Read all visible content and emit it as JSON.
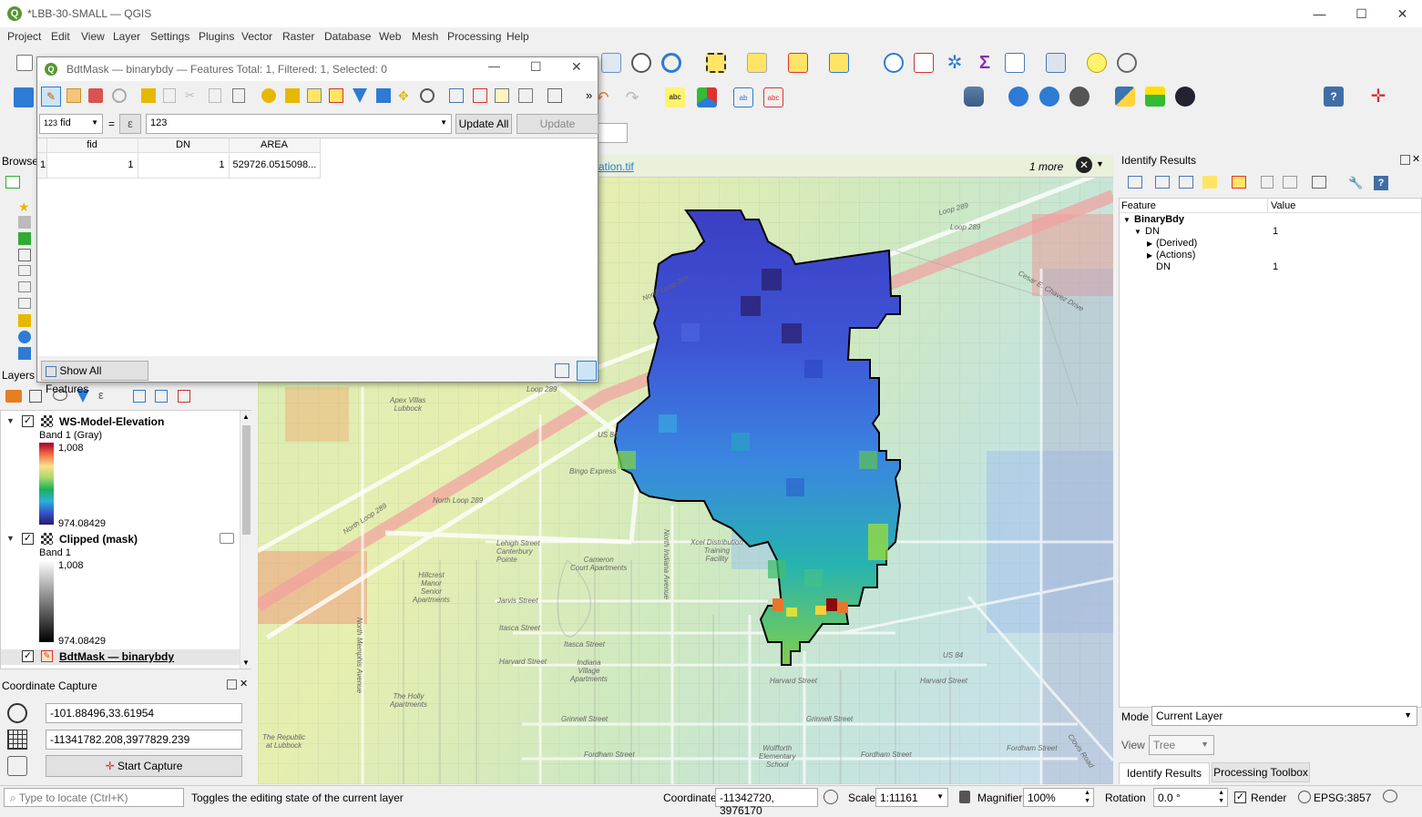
{
  "window": {
    "title": "*LBB-30-SMALL — QGIS",
    "minimize": "—",
    "maximize": "☐",
    "close": "✕"
  },
  "menu": [
    "Project",
    "Edit",
    "View",
    "Layer",
    "Settings",
    "Plugins",
    "Vector",
    "Raster",
    "Database",
    "Web",
    "Mesh",
    "Processing",
    "Help"
  ],
  "attribute_table": {
    "title": "BdtMask — binarybdy — Features Total: 1, Filtered: 1, Selected: 0",
    "field_select": "fid",
    "field_prefix": "123",
    "equals": "=",
    "expression_symbol": "ε",
    "expression_value": "123",
    "update_all": "Update All",
    "update_selected": "Update Selected",
    "more": "»",
    "columns": [
      "fid",
      "DN",
      "AREA"
    ],
    "rows": [
      {
        "row": "1",
        "fid": "1",
        "DN": "1",
        "AREA": "529726.0515098..."
      }
    ],
    "show_all": "Show All Features"
  },
  "map_header": {
    "file_hint": "ation.tif",
    "more": "1 more"
  },
  "browser_label": "Browser",
  "layers": {
    "label": "Layers",
    "items": [
      {
        "name": "WS-Model-Elevation",
        "band": "Band 1 (Gray)",
        "max": "1,008",
        "min": "974.08429"
      },
      {
        "name": "Clipped (mask)",
        "band": "Band 1",
        "max": "1,008",
        "min": "974.08429"
      },
      {
        "name": "BdtMask — binarybdy"
      }
    ]
  },
  "coordinate_capture": {
    "title": "Coordinate Capture",
    "wgs84": "-101.88496,33.61954",
    "projected": "-11341782.208,3977829.239",
    "start": "Start Capture"
  },
  "identify": {
    "title": "Identify Results",
    "col_feature": "Feature",
    "col_value": "Value",
    "layer": "BinaryBdy",
    "field": "DN",
    "field_value": "1",
    "derived": "(Derived)",
    "actions": "(Actions)",
    "dn_label": "DN",
    "dn_value": "1",
    "mode_label": "Mode",
    "mode_value": "Current Layer",
    "view_label": "View",
    "view_value": "Tree",
    "tab_identify": "Identify Results",
    "tab_processing": "Processing Toolbox"
  },
  "map_labels": {
    "loop289_a": "Loop 289",
    "loop289_b": "Loop 289",
    "loop289_c": "Loop 289",
    "north_loop_a": "North Loop 289",
    "north_loop_b": "North Loop 289",
    "north_loop_c": "North Loop 289",
    "apex": "Apex Villas\nLubbock",
    "cameron": "Cameron\nCourt Apartments",
    "hillcrest": "Hillcrest\nManor\nSenior\nApartments",
    "holly": "The Holly\nApartments",
    "republic": "The Republic\nat Lubbock",
    "wolfforth": "Wolfforth\nElementary\nSchool",
    "lehigh": "Lehigh Street",
    "canterbury": "Canterbury\nPointe",
    "jarvis": "Jarvis Street",
    "itasca": "Itasca Street",
    "itasca2": "Itasca Street",
    "harvard": "Harvard Street",
    "harvard2": "Harvard Street",
    "harvard3": "Harvard Street",
    "grinnell": "Grinnell Street",
    "grinnell2": "Grinnell Street",
    "fordham": "Fordham Street",
    "fordham2": "Fordham Street",
    "fordham3": "Fordham Street",
    "us84": "US 84",
    "us84b": "US 84",
    "xcel": "Xcel Distribution\nTraining\nFacility",
    "bingo": "Bingo Express",
    "cesar": "Cesar E. Chavez Drive",
    "indiana": "North Indiana Avenue",
    "memphis": "North Memphis Avenue",
    "clovis": "Clovis Road",
    "indiana_village": "Indiana\nVillage\nApartments"
  },
  "status": {
    "search_placeholder": "Type to locate (Ctrl+K)",
    "message": "Toggles the editing state of the current layer",
    "coord_label": "Coordinate",
    "coord_value": "-11342720, 3976170",
    "scale_label": "Scale",
    "scale_value": "1:11161",
    "magnifier_label": "Magnifier",
    "magnifier_value": "100%",
    "rotation_label": "Rotation",
    "rotation_value": "0.0 °",
    "render_label": "Render",
    "crs": "EPSG:3857"
  },
  "colors": {
    "qgis_green": "#589632",
    "accent_blue": "#0078d7"
  }
}
